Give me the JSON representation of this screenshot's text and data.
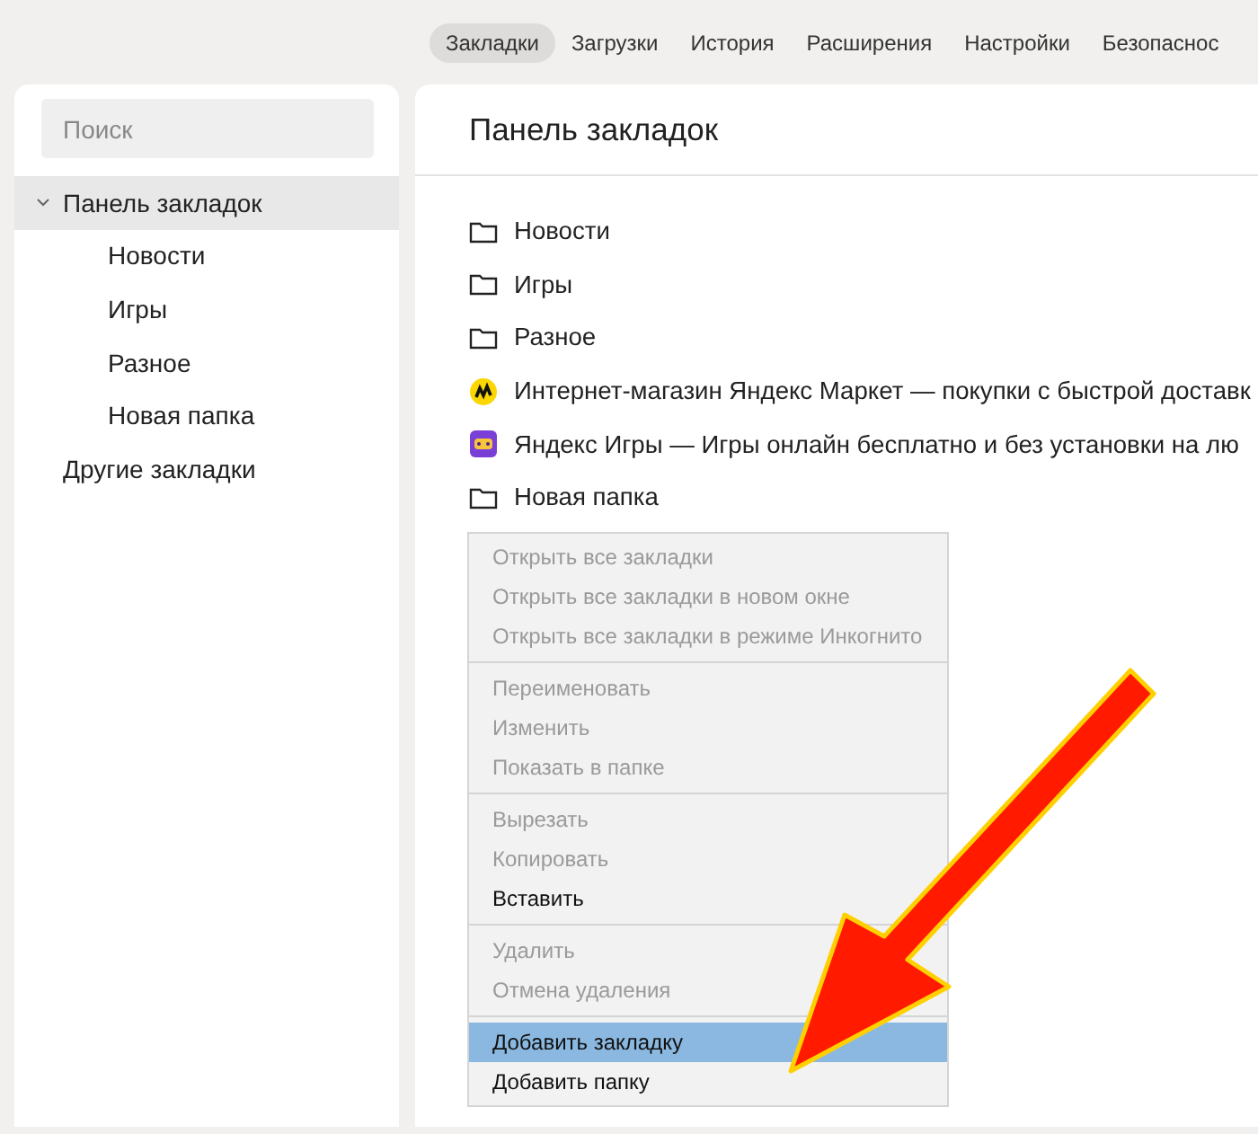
{
  "nav_tabs": [
    {
      "label": "Закладки",
      "selected": true
    },
    {
      "label": "Загрузки",
      "selected": false
    },
    {
      "label": "История",
      "selected": false
    },
    {
      "label": "Расширения",
      "selected": false
    },
    {
      "label": "Настройки",
      "selected": false
    },
    {
      "label": "Безопаснос",
      "selected": false
    }
  ],
  "sidebar": {
    "search": {
      "placeholder": "Поиск"
    },
    "tree": [
      {
        "label": "Панель закладок",
        "selected": true,
        "expanded": true,
        "children": [
          {
            "label": "Новости",
            "selected": false
          },
          {
            "label": "Игры",
            "selected": false
          },
          {
            "label": "Разное",
            "selected": false
          },
          {
            "label": "Новая папка",
            "selected": false
          }
        ]
      },
      {
        "label": "Другие закладки",
        "selected": false
      }
    ]
  },
  "main": {
    "title": "Панель закладок",
    "items": [
      {
        "kind": "folder",
        "label": "Новости"
      },
      {
        "kind": "folder",
        "label": "Игры"
      },
      {
        "kind": "folder",
        "label": "Разное"
      },
      {
        "kind": "market-site",
        "label": "Интернет-магазин Яндекс Маркет — покупки с быстрой доставк"
      },
      {
        "kind": "games-site",
        "label": "Яндекс Игры — Игры онлайн бесплатно и без установки на лю"
      },
      {
        "kind": "folder",
        "label": "Новая папка"
      }
    ]
  },
  "context_menu": {
    "groups": [
      [
        {
          "label": "Открыть все закладки",
          "disabled": true,
          "selected": false
        },
        {
          "label": "Открыть все закладки в новом окне",
          "disabled": true,
          "selected": false
        },
        {
          "label": "Открыть все закладки в режиме Инкогнито",
          "disabled": true,
          "selected": false
        }
      ],
      [
        {
          "label": "Переименовать",
          "disabled": true,
          "selected": false
        },
        {
          "label": "Изменить",
          "disabled": true,
          "selected": false
        },
        {
          "label": "Показать в папке",
          "disabled": true,
          "selected": false
        }
      ],
      [
        {
          "label": "Вырезать",
          "disabled": true,
          "selected": false
        },
        {
          "label": "Копировать",
          "disabled": true,
          "selected": false
        },
        {
          "label": "Вставить",
          "disabled": false,
          "selected": false
        }
      ],
      [
        {
          "label": "Удалить",
          "disabled": true,
          "selected": false
        },
        {
          "label": "Отмена удаления",
          "disabled": true,
          "selected": false
        }
      ],
      [
        {
          "label": "Добавить закладку",
          "disabled": false,
          "selected": true
        },
        {
          "label": "Добавить папку",
          "disabled": false,
          "selected": false
        }
      ]
    ]
  }
}
